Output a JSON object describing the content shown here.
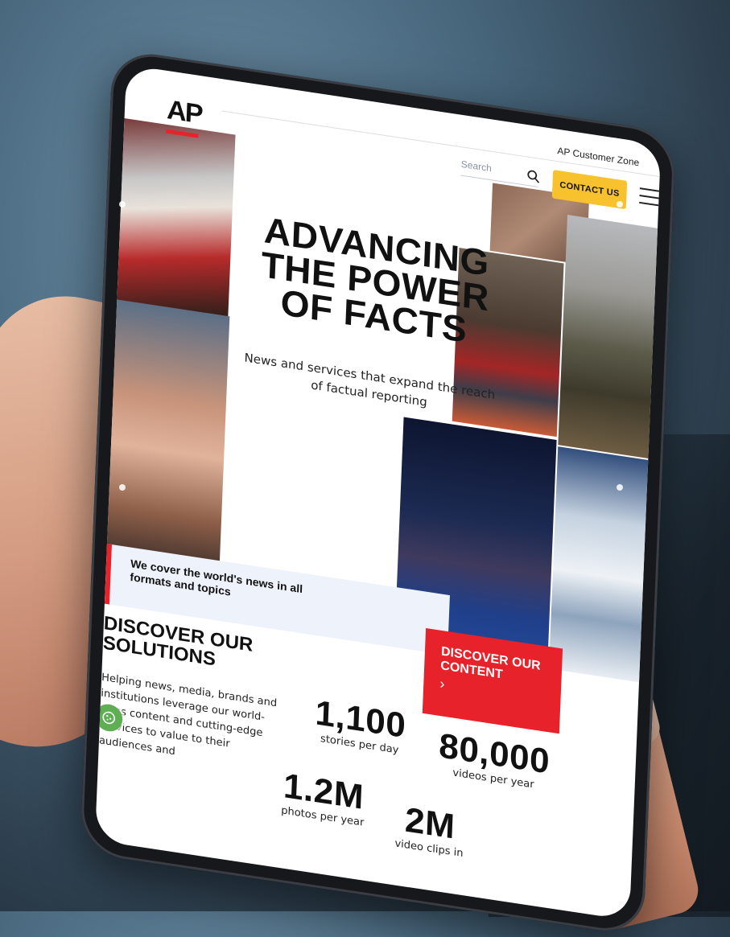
{
  "header": {
    "logo_text": "AP",
    "customer_zone": "AP Customer Zone",
    "search_placeholder": "Search",
    "contact_label": "CONTACT US",
    "menu_icon": "hamburger-menu-icon",
    "search_icon": "search-icon"
  },
  "hero": {
    "title_line1": "ADVANCING",
    "title_line2": "THE POWER",
    "title_line3": "OF FACTS",
    "subtitle": "News and services that expand the reach of factual reporting"
  },
  "cover": {
    "text": "We cover the world's news in all formats and topics"
  },
  "discover_content": {
    "label": "DISCOVER OUR CONTENT",
    "arrow": "›"
  },
  "solutions": {
    "title": "DISCOVER OUR SOLUTIONS",
    "text": "Helping news, media, brands and institutions leverage our world-class content and cutting-edge services to value to their audiences and"
  },
  "stats": [
    {
      "value": "1,100",
      "label": "stories per day"
    },
    {
      "value": "80,000",
      "label": "videos per year"
    },
    {
      "value": "1.2M",
      "label": "photos per year"
    },
    {
      "value": "2M",
      "label": "video clips in"
    }
  ],
  "colors": {
    "accent_red": "#e8222a",
    "contact_yellow": "#f8c22e",
    "cookie_green": "#5fae54"
  }
}
